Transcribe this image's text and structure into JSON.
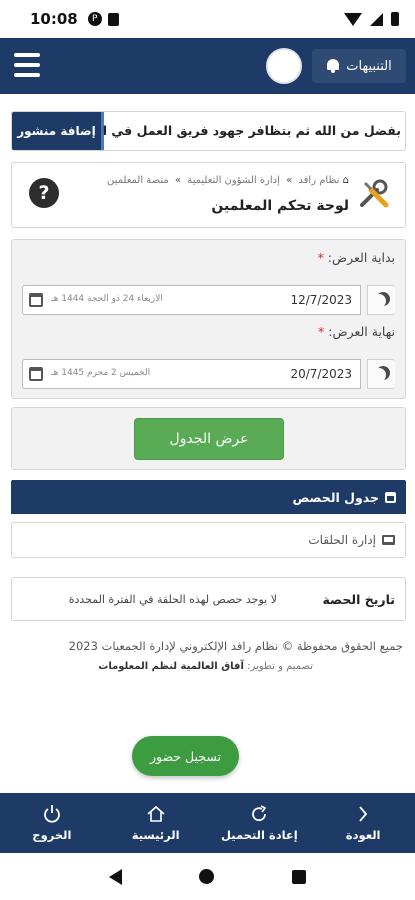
{
  "status_bar": {
    "time": "10:08"
  },
  "header": {
    "notifications_label": "التنبيهات",
    "colors": {
      "primary": "#1d3b66",
      "success": "#5aab55"
    }
  },
  "ticker": {
    "add_post_label": "إضافة منشور",
    "text": "بفضل من الله ثم بتظافر جهود فريق العمل في الجمعية"
  },
  "breadcrumb": {
    "home": "نظام رافد",
    "section": "إدارة الشؤون التعليمية",
    "current": "منصة المعلمين",
    "page_title": "لوحة تحكم المعلمين"
  },
  "filters": {
    "start_label": "بداية العرض:",
    "start_date": "12/7/2023",
    "start_hijri": "الاربعاء 24 ذو الحجة 1444 هـ",
    "end_label": "نهاية العرض:",
    "end_date": "20/7/2023",
    "end_hijri": "الخميس 2 محرم 1445 هـ",
    "required_mark": "*",
    "show_button": "عرض الجدول"
  },
  "schedule": {
    "header": "جدول الحصص",
    "manage_circles": "إدارة الحلقات",
    "date_label": "تاريخ الحصة",
    "empty_message": "لا يوجد حصص لهذه الحلقة في الفترة المحددة"
  },
  "footer": {
    "copyright": "جميع الحقوق محفوظة © نظام رافد الإلكتروني لإدارة الجمعيات 2023",
    "credit_prefix": "تصميم و تطوير:",
    "credit_company": "آفاق العالمية لنظم المعلومات"
  },
  "attendance_button": "تسجيل حضور",
  "bottom_nav": {
    "logout": "الخروج",
    "home": "الرئيسية",
    "reload": "إعادة التحميل",
    "back": "العودة"
  }
}
